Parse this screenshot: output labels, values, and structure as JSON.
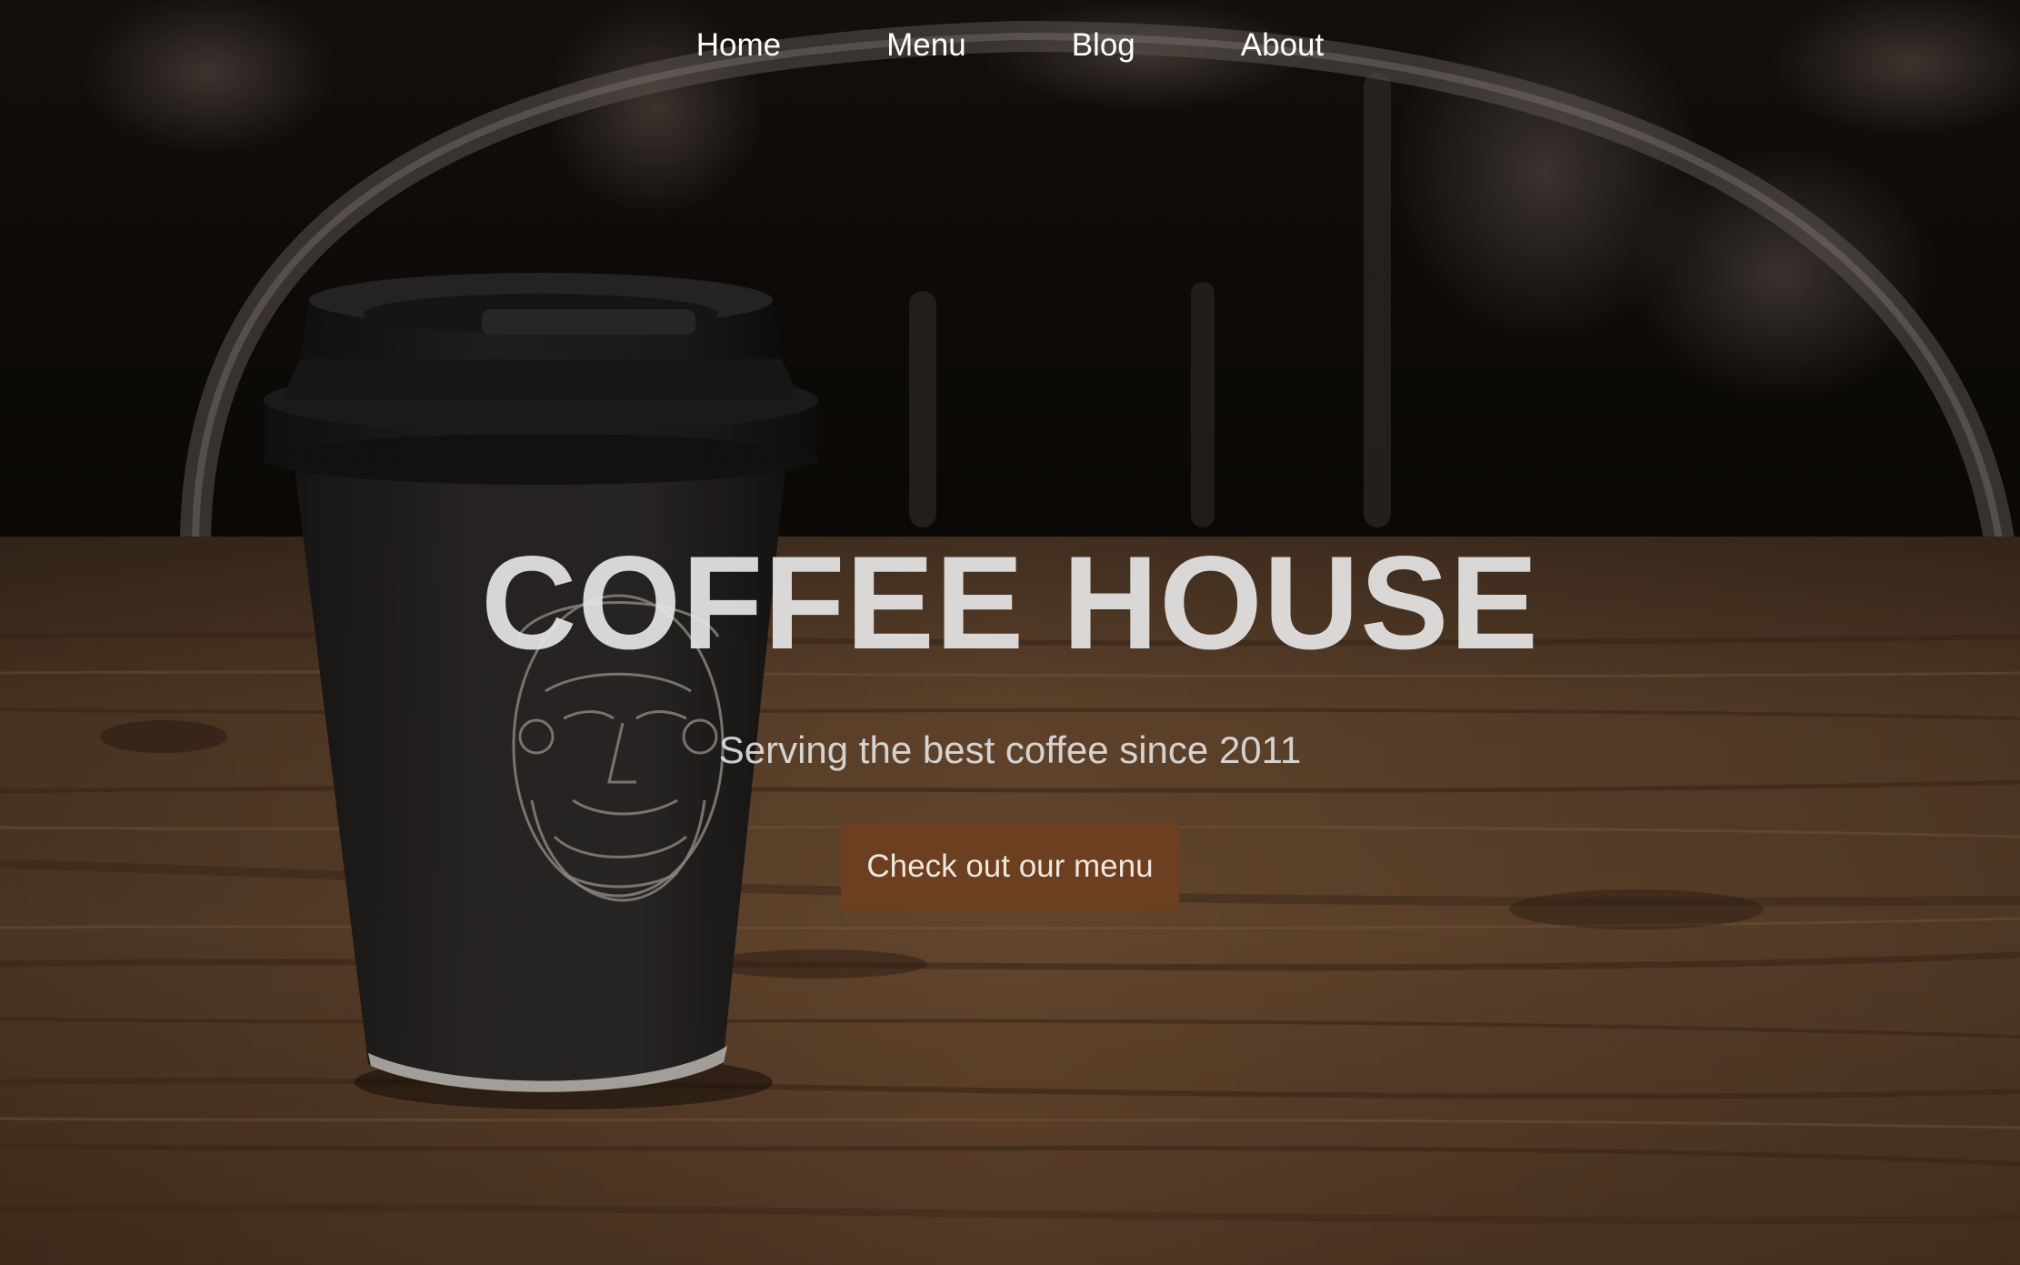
{
  "nav": {
    "items": [
      {
        "label": "Home"
      },
      {
        "label": "Menu"
      },
      {
        "label": "Blog"
      },
      {
        "label": "About"
      }
    ]
  },
  "hero": {
    "title": "COFFEE HOUSE",
    "subtitle": "Serving the best coffee since 2011",
    "cta_label": "Check out our menu",
    "background_image": "coffee cup on wooden table with chair behind"
  },
  "colors": {
    "nav_text": "#ffffff",
    "title_text": "#e6e6e6",
    "cta_background": "#6b3f20",
    "cta_text": "#efe6dc",
    "table_wood": "#5a3e28",
    "background_dark": "#0d0a08"
  }
}
